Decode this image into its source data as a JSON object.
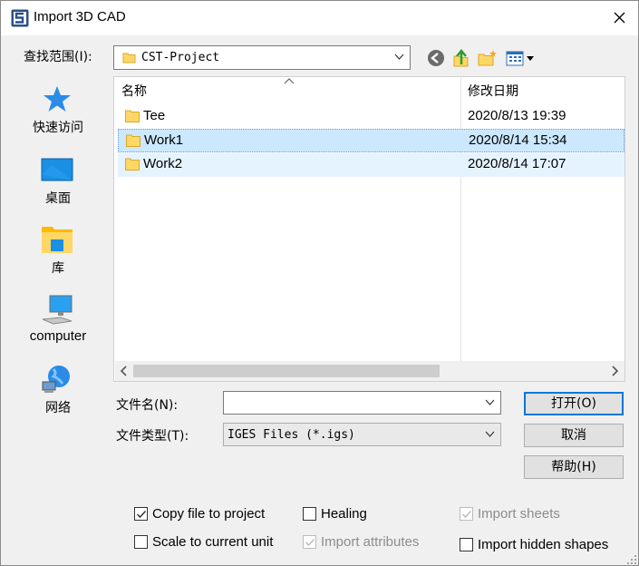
{
  "window": {
    "title": "Import 3D CAD"
  },
  "look_in": {
    "label": "查找范围(I):",
    "value": "CST-Project"
  },
  "places": [
    {
      "label": "快速访问",
      "icon": "star-icon"
    },
    {
      "label": "桌面",
      "icon": "desktop-icon"
    },
    {
      "label": "库",
      "icon": "library-icon"
    },
    {
      "label": "computer",
      "icon": "computer-icon"
    },
    {
      "label": "网络",
      "icon": "network-icon"
    }
  ],
  "file_list": {
    "columns": [
      "名称",
      "修改日期"
    ],
    "rows": [
      {
        "name": "Tee",
        "date": "2020/8/13 19:39",
        "state": "normal"
      },
      {
        "name": "Work1",
        "date": "2020/8/14 15:34",
        "state": "selected"
      },
      {
        "name": "Work2",
        "date": "2020/8/14 17:07",
        "state": "hover"
      }
    ]
  },
  "file_name": {
    "label": "文件名(N):",
    "value": "",
    "placeholder": ""
  },
  "file_type": {
    "label": "文件类型(T):",
    "value": "IGES Files (*.igs)"
  },
  "buttons": {
    "open": "打开(O)",
    "cancel": "取消",
    "help": "帮助(H)"
  },
  "options": {
    "copy_file": {
      "label": "Copy file to project",
      "checked": true,
      "enabled": true
    },
    "scale_unit": {
      "label": "Scale to current unit",
      "checked": false,
      "enabled": true
    },
    "healing": {
      "label": "Healing",
      "checked": false,
      "enabled": true
    },
    "import_attributes": {
      "label": "Import attributes",
      "checked": true,
      "enabled": false
    },
    "import_sheets": {
      "label": "Import sheets",
      "checked": true,
      "enabled": false
    },
    "import_hidden": {
      "label": "Import hidden shapes",
      "checked": false,
      "enabled": true
    }
  },
  "colors": {
    "selection": "#cce8ff",
    "hover": "#e5f3ff",
    "accent": "#0078d7",
    "folder": "#ffd766"
  }
}
